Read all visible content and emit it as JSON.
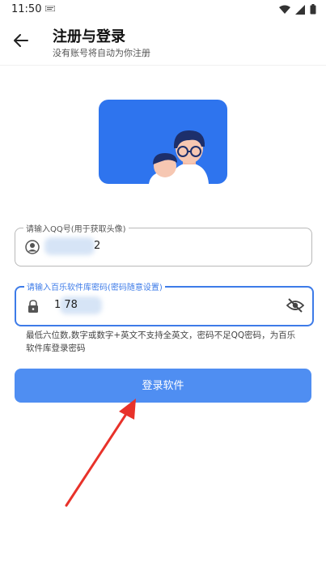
{
  "status_bar": {
    "time": "11:50"
  },
  "header": {
    "title": "注册与登录",
    "subtitle": "没有账号将自动为你注册"
  },
  "qq_field": {
    "label": "请输入QQ号(用于获取头像)",
    "value": "2"
  },
  "password_field": {
    "label": "请输入百乐软件库密码(密码随意设置)",
    "value": "1         78"
  },
  "hint": "最低六位数,数字或数字+英文不支持全英文，密码不足QQ密码，为百乐软件库登录密码",
  "login_button": {
    "label": "登录软件"
  },
  "colors": {
    "primary": "#4f8ef2",
    "illustration_bg": "#2e74ee",
    "annotation_arrow": "#e8322a"
  }
}
